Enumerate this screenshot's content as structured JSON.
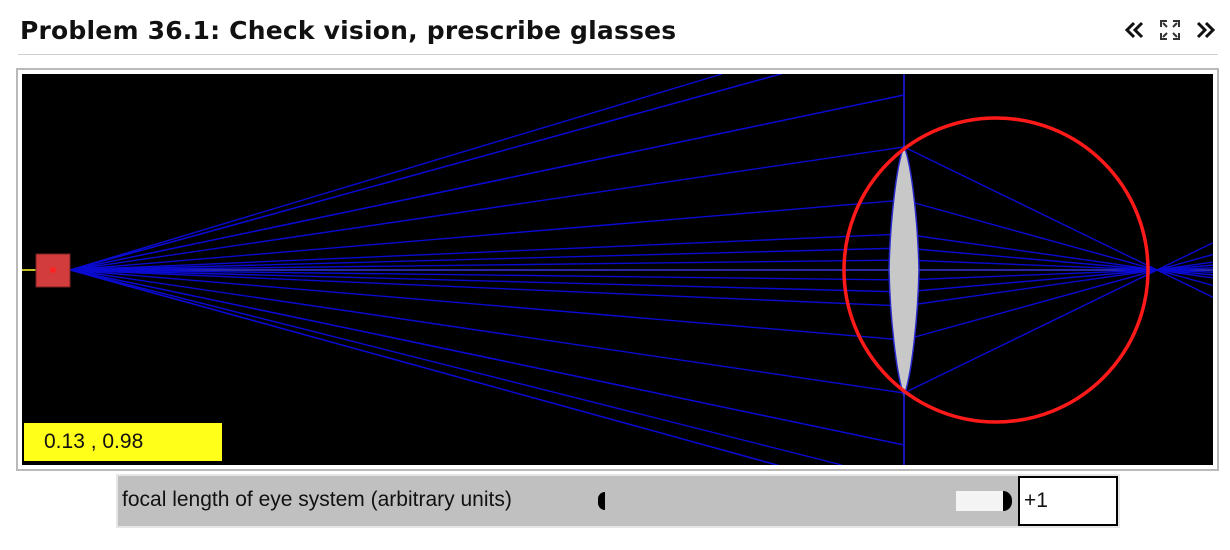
{
  "header": {
    "title": "Problem 36.1: Check vision, prescribe glasses",
    "nav_icons": [
      "double-chevron-left-icon",
      "fullscreen-icon",
      "double-chevron-right-icon"
    ]
  },
  "simulation": {
    "background_color": "#000000",
    "ray_color": "#0a0ad0",
    "axis_color": "#ffff33",
    "eye_circle_color": "#ff1a1a",
    "lens_color": "#c8c8c8",
    "source_color": "#d23c3c",
    "coordinate_readout": "0.13 , 0.98"
  },
  "controls": {
    "label": "focal length of eye system (arbitrary units)",
    "value": "+1",
    "slider_fraction": 1.0
  }
}
